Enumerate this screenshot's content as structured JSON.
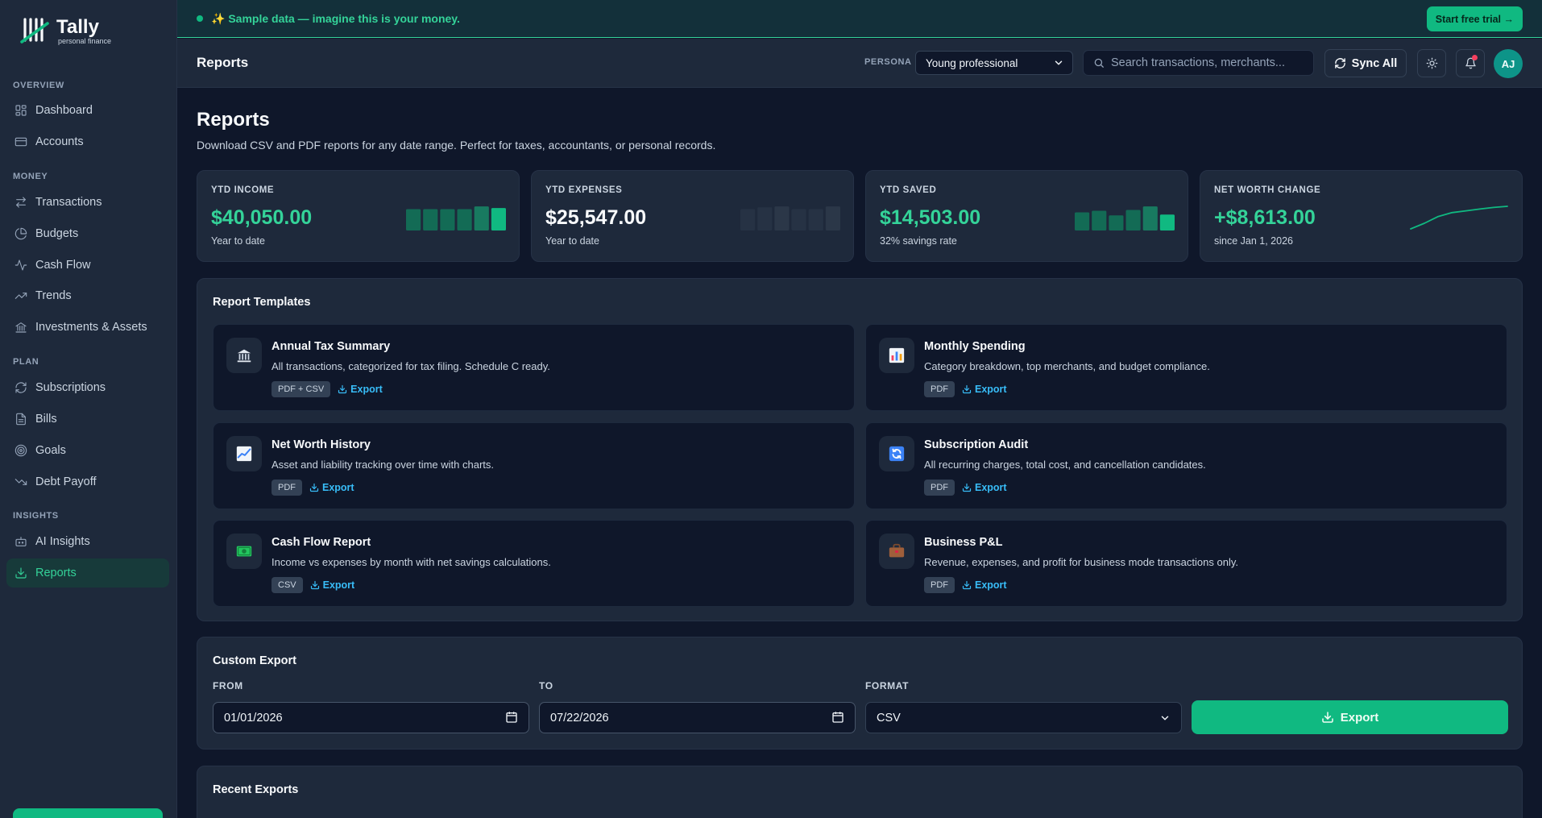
{
  "brand": {
    "name": "Tally",
    "tagline": "personal finance"
  },
  "sidebar": {
    "sections": [
      {
        "label": "OVERVIEW"
      },
      {
        "label": "MONEY"
      },
      {
        "label": "PLAN"
      },
      {
        "label": "INSIGHTS"
      }
    ],
    "items": [
      {
        "label": "Dashboard",
        "icon": "dashboard-icon"
      },
      {
        "label": "Accounts",
        "icon": "credit-card-icon"
      },
      {
        "label": "Transactions",
        "icon": "arrows-swap-icon"
      },
      {
        "label": "Budgets",
        "icon": "pie-chart-icon"
      },
      {
        "label": "Cash Flow",
        "icon": "activity-icon"
      },
      {
        "label": "Trends",
        "icon": "trending-up-icon"
      },
      {
        "label": "Investments & Assets",
        "icon": "bank-icon"
      },
      {
        "label": "Subscriptions",
        "icon": "refresh-icon"
      },
      {
        "label": "Bills",
        "icon": "document-icon"
      },
      {
        "label": "Goals",
        "icon": "target-icon"
      },
      {
        "label": "Debt Payoff",
        "icon": "trending-down-icon"
      },
      {
        "label": "AI Insights",
        "icon": "robot-icon"
      },
      {
        "label": "Reports",
        "icon": "download-icon",
        "active": true
      }
    ]
  },
  "banner": {
    "text": "✨ Sample data — imagine this is your money.",
    "cta": "Start free trial →"
  },
  "header": {
    "title": "Reports",
    "persona_label": "PERSONA",
    "persona_value": "Young professional",
    "search_placeholder": "Search transactions, merchants...",
    "sync_label": "Sync All",
    "avatar_initials": "AJ"
  },
  "page": {
    "title": "Reports",
    "subtitle": "Download CSV and PDF reports for any date range. Perfect for taxes, accountants, or personal records."
  },
  "stats": [
    {
      "label": "YTD INCOME",
      "value": "$40,050.00",
      "note": "Year to date",
      "color": "#34d399",
      "spark": [
        0.78,
        0.78,
        0.78,
        0.78,
        0.88,
        0.82
      ]
    },
    {
      "label": "YTD EXPENSES",
      "value": "$25,547.00",
      "note": "Year to date",
      "color": "#f8fafc",
      "spark": [
        0.78,
        0.85,
        0.88,
        0.78,
        0.78,
        0.88
      ]
    },
    {
      "label": "YTD SAVED",
      "value": "$14,503.00",
      "note": "32% savings rate",
      "color": "#34d399",
      "spark": [
        0.66,
        0.72,
        0.55,
        0.75,
        0.88,
        0.58
      ]
    },
    {
      "label": "NET WORTH CHANGE",
      "value": "+$8,613.00",
      "note": "since Jan 1, 2026",
      "color": "#34d399",
      "spark": [
        0.0,
        0.25,
        0.55,
        0.72,
        0.8,
        0.88,
        0.95,
        1.0
      ]
    }
  ],
  "templates": {
    "title": "Report Templates",
    "export_label": "Export",
    "items": [
      {
        "name": "Annual Tax Summary",
        "desc": "All transactions, categorized for tax filing. Schedule C ready.",
        "badge": "PDF + CSV",
        "icon": "bank-icon"
      },
      {
        "name": "Monthly Spending",
        "desc": "Category breakdown, top merchants, and budget compliance.",
        "badge": "PDF",
        "icon": "bar-chart-icon"
      },
      {
        "name": "Net Worth History",
        "desc": "Asset and liability tracking over time with charts.",
        "badge": "PDF",
        "icon": "line-chart-icon"
      },
      {
        "name": "Subscription Audit",
        "desc": "All recurring charges, total cost, and cancellation candidates.",
        "badge": "PDF",
        "icon": "refresh-icon"
      },
      {
        "name": "Cash Flow Report",
        "desc": "Income vs expenses by month with net savings calculations.",
        "badge": "CSV",
        "icon": "money-icon"
      },
      {
        "name": "Business P&L",
        "desc": "Revenue, expenses, and profit for business mode transactions only.",
        "badge": "PDF",
        "icon": "briefcase-icon"
      }
    ]
  },
  "custom_export": {
    "title": "Custom Export",
    "from_label": "FROM",
    "from_value": "01/01/2026",
    "to_label": "TO",
    "to_value": "07/22/2026",
    "format_label": "FORMAT",
    "format_value": "CSV",
    "button": "Export"
  },
  "recent": {
    "title": "Recent Exports"
  },
  "colors": {
    "accent": "#10b981",
    "link": "#38bdf8",
    "bg": "#0f172a",
    "card": "#1e293b"
  }
}
